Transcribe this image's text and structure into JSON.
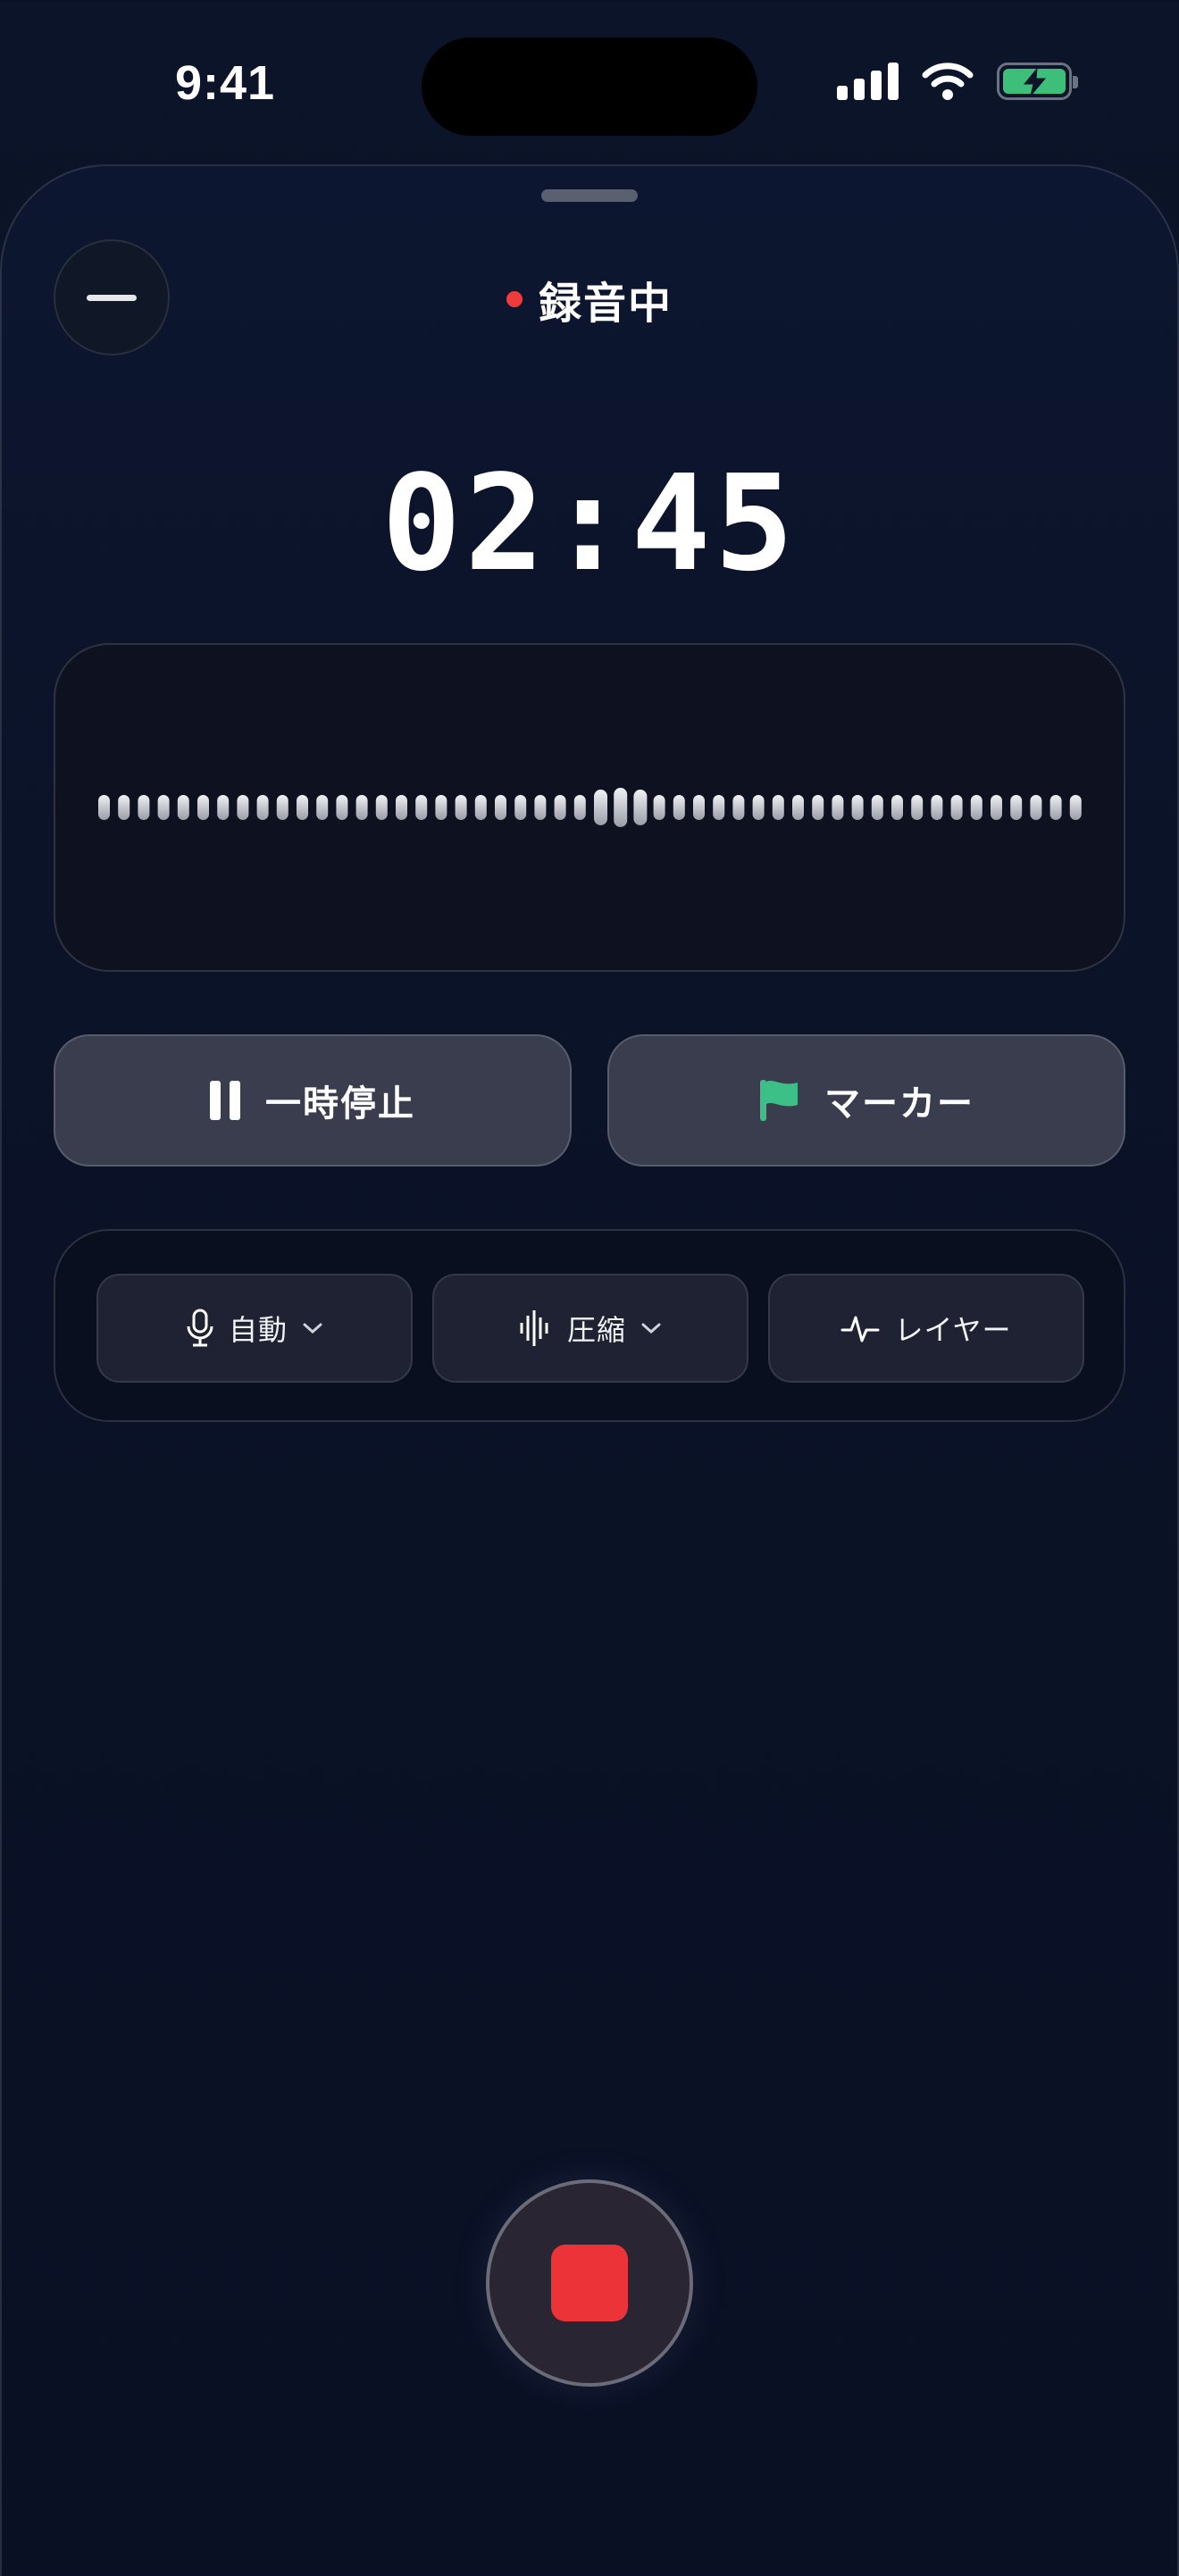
{
  "status_bar": {
    "time": "9:41"
  },
  "recording": {
    "status_label": "録音中",
    "elapsed": "02:45"
  },
  "actions": {
    "pause_label": "一時停止",
    "marker_label": "マーカー"
  },
  "options": {
    "input_label": "自動",
    "compression_label": "圧縮",
    "layer_label": "レイヤー"
  },
  "icons": {
    "minimize": "minus-icon",
    "pause": "pause-icon",
    "marker": "flag-icon",
    "input": "microphone-icon",
    "compression": "waveform-icon",
    "layer": "pulse-icon",
    "stop": "stop-icon"
  },
  "colors": {
    "recording_red": "#ef3b3b",
    "marker_green": "#3dbf88",
    "battery_green": "#3dbf7a"
  }
}
